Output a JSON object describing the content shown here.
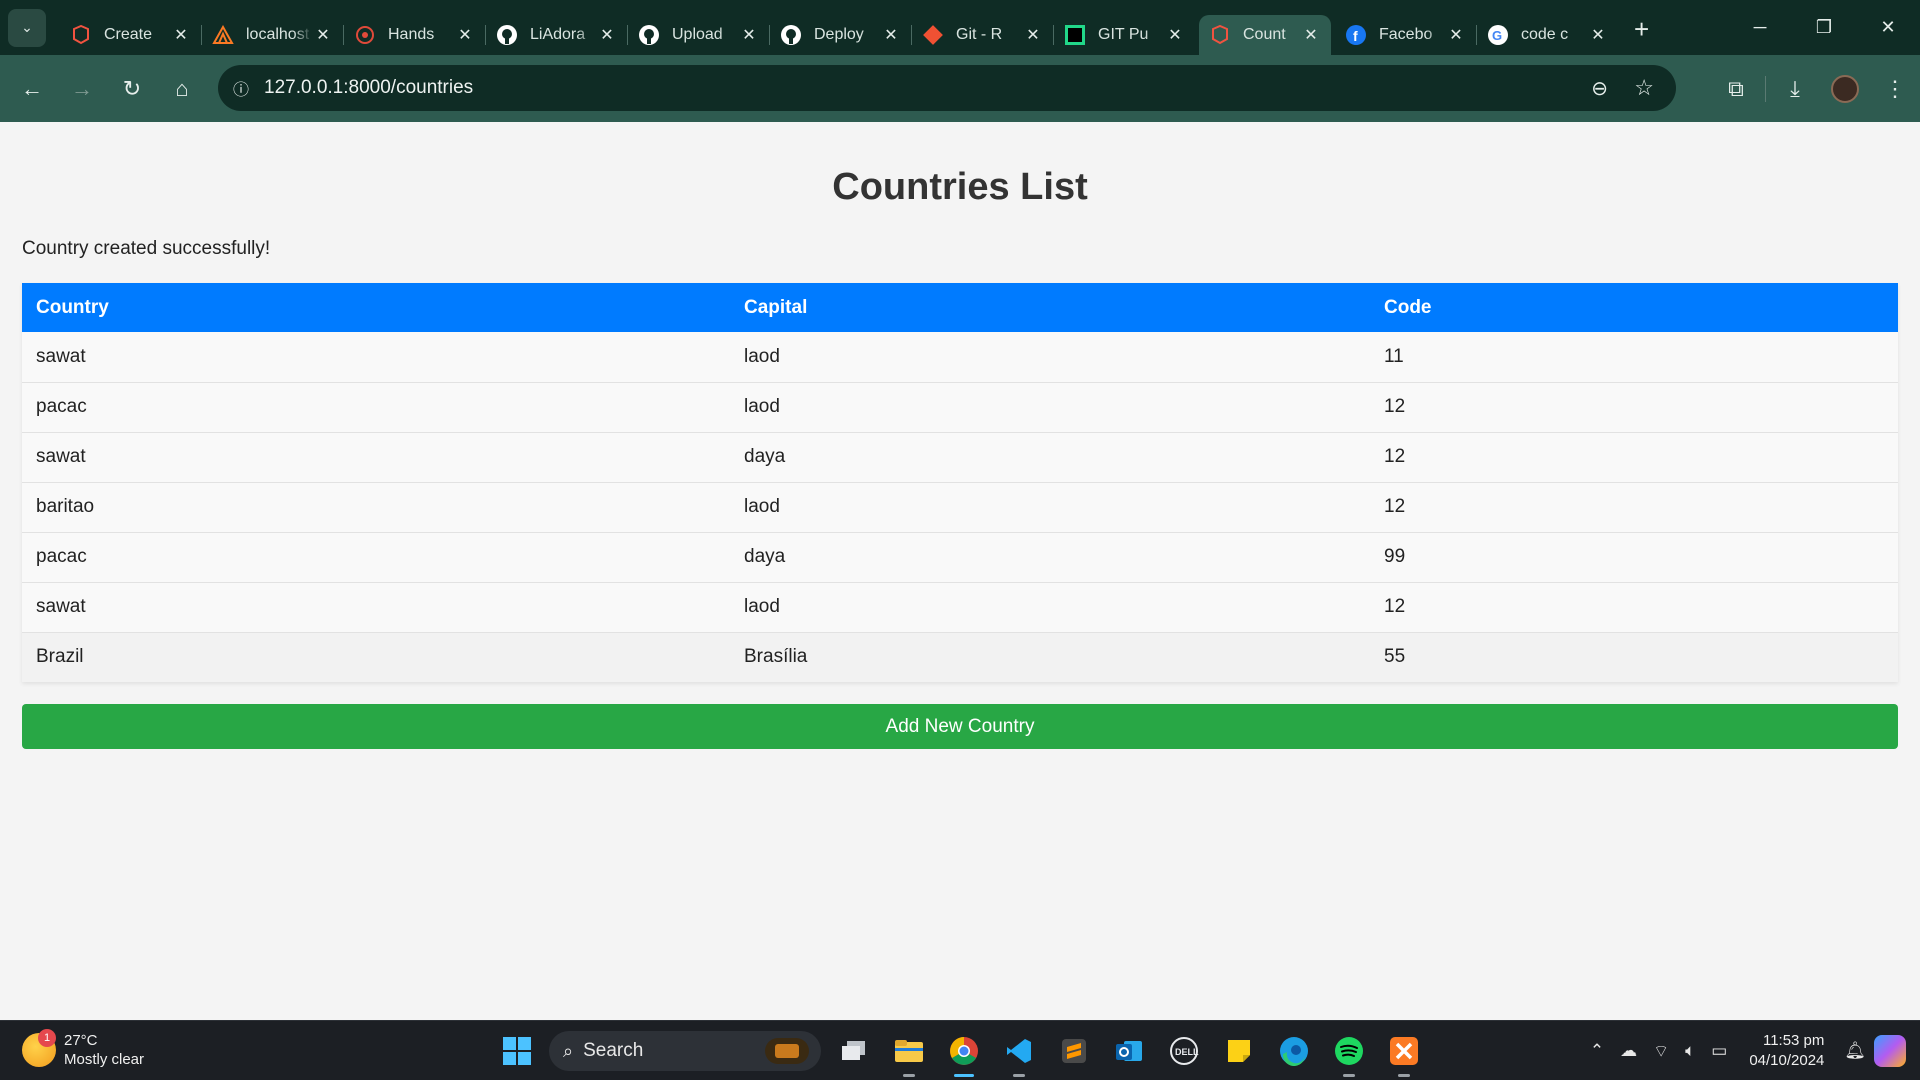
{
  "browser": {
    "tabs": [
      {
        "title": "Create",
        "icon": "laravel-icon",
        "color": "#f05340"
      },
      {
        "title": "localhost",
        "icon": "xampp-icon",
        "color": "#fb7a24"
      },
      {
        "title": "Hands",
        "icon": "hands-icon",
        "color": "#e04a3a"
      },
      {
        "title": "LiAdora",
        "icon": "github-icon",
        "color": "#ffffff"
      },
      {
        "title": "Upload",
        "icon": "github-icon",
        "color": "#ffffff"
      },
      {
        "title": "Deploy",
        "icon": "github-icon",
        "color": "#ffffff"
      },
      {
        "title": "Git - R",
        "icon": "git-icon",
        "color": "#f05133"
      },
      {
        "title": "GIT Pu",
        "icon": "pycharm-icon",
        "color": "#21d789"
      },
      {
        "title": "Count",
        "icon": "laravel-icon",
        "color": "#f05340",
        "active": true
      },
      {
        "title": "Facebo",
        "icon": "facebook-icon",
        "color": "#1877f2"
      },
      {
        "title": "code c",
        "icon": "google-icon",
        "color": "#4285f4"
      }
    ],
    "url": "127.0.0.1:8000/countries"
  },
  "page": {
    "title": "Countries List",
    "flash_message": "Country created successfully!",
    "table": {
      "headers": [
        "Country",
        "Capital",
        "Code"
      ],
      "rows": [
        [
          "sawat",
          "laod",
          "11"
        ],
        [
          "pacac",
          "laod",
          "12"
        ],
        [
          "sawat",
          "daya",
          "12"
        ],
        [
          "baritao",
          "laod",
          "12"
        ],
        [
          "pacac",
          "daya",
          "99"
        ],
        [
          "sawat",
          "laod",
          "12"
        ],
        [
          "Brazil",
          "Brasília",
          "55"
        ]
      ]
    },
    "add_button_label": "Add New Country",
    "colors": {
      "header": "#007bff",
      "add_button": "#28a745"
    }
  },
  "taskbar": {
    "weather": {
      "temp": "27°C",
      "condition": "Mostly clear",
      "badge": "1"
    },
    "search_label": "Search",
    "time": "11:53 pm",
    "date": "04/10/2024"
  }
}
